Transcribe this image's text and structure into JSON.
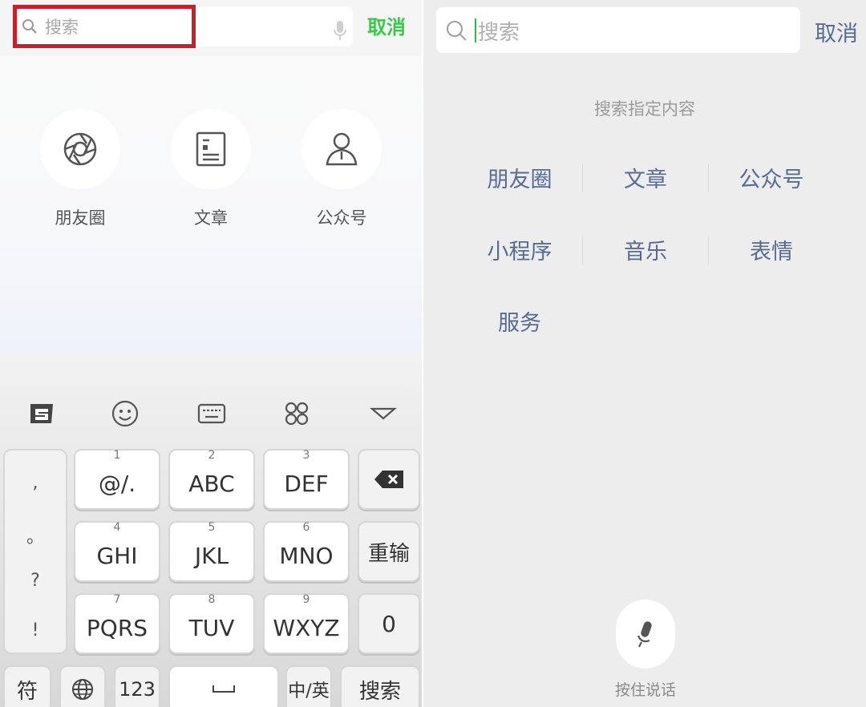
{
  "left": {
    "search": {
      "placeholder": "搜索",
      "cancel_label": "取消"
    },
    "categories": [
      {
        "label": "朋友圈",
        "icon": "shutter-icon"
      },
      {
        "label": "文章",
        "icon": "article-icon"
      },
      {
        "label": "公众号",
        "icon": "person-icon"
      }
    ],
    "keyboard": {
      "punct_keys": [
        ",",
        "。",
        "?",
        "!"
      ],
      "keys": [
        {
          "num": "1",
          "label": "@/."
        },
        {
          "num": "2",
          "label": "ABC"
        },
        {
          "num": "3",
          "label": "DEF"
        },
        {
          "num": "4",
          "label": "GHI"
        },
        {
          "num": "5",
          "label": "JKL"
        },
        {
          "num": "6",
          "label": "MNO"
        },
        {
          "num": "7",
          "label": "PQRS"
        },
        {
          "num": "8",
          "label": "TUV"
        },
        {
          "num": "9",
          "label": "WXYZ"
        }
      ],
      "retype_label": "重输",
      "zero_label": "0",
      "symbols_label": "符",
      "num_label": "123",
      "lang_label": "中/英",
      "search_label": "搜索"
    }
  },
  "right": {
    "search": {
      "placeholder": "搜索",
      "cancel_label": "取消"
    },
    "hint": "搜索指定内容",
    "options": [
      "朋友圈",
      "文章",
      "公众号",
      "小程序",
      "音乐",
      "表情",
      "服务"
    ],
    "voice_label": "按住说话"
  },
  "colors": {
    "accent_green": "#3cc84a",
    "link_blue": "#576b95",
    "highlight_red": "#c8202b"
  }
}
